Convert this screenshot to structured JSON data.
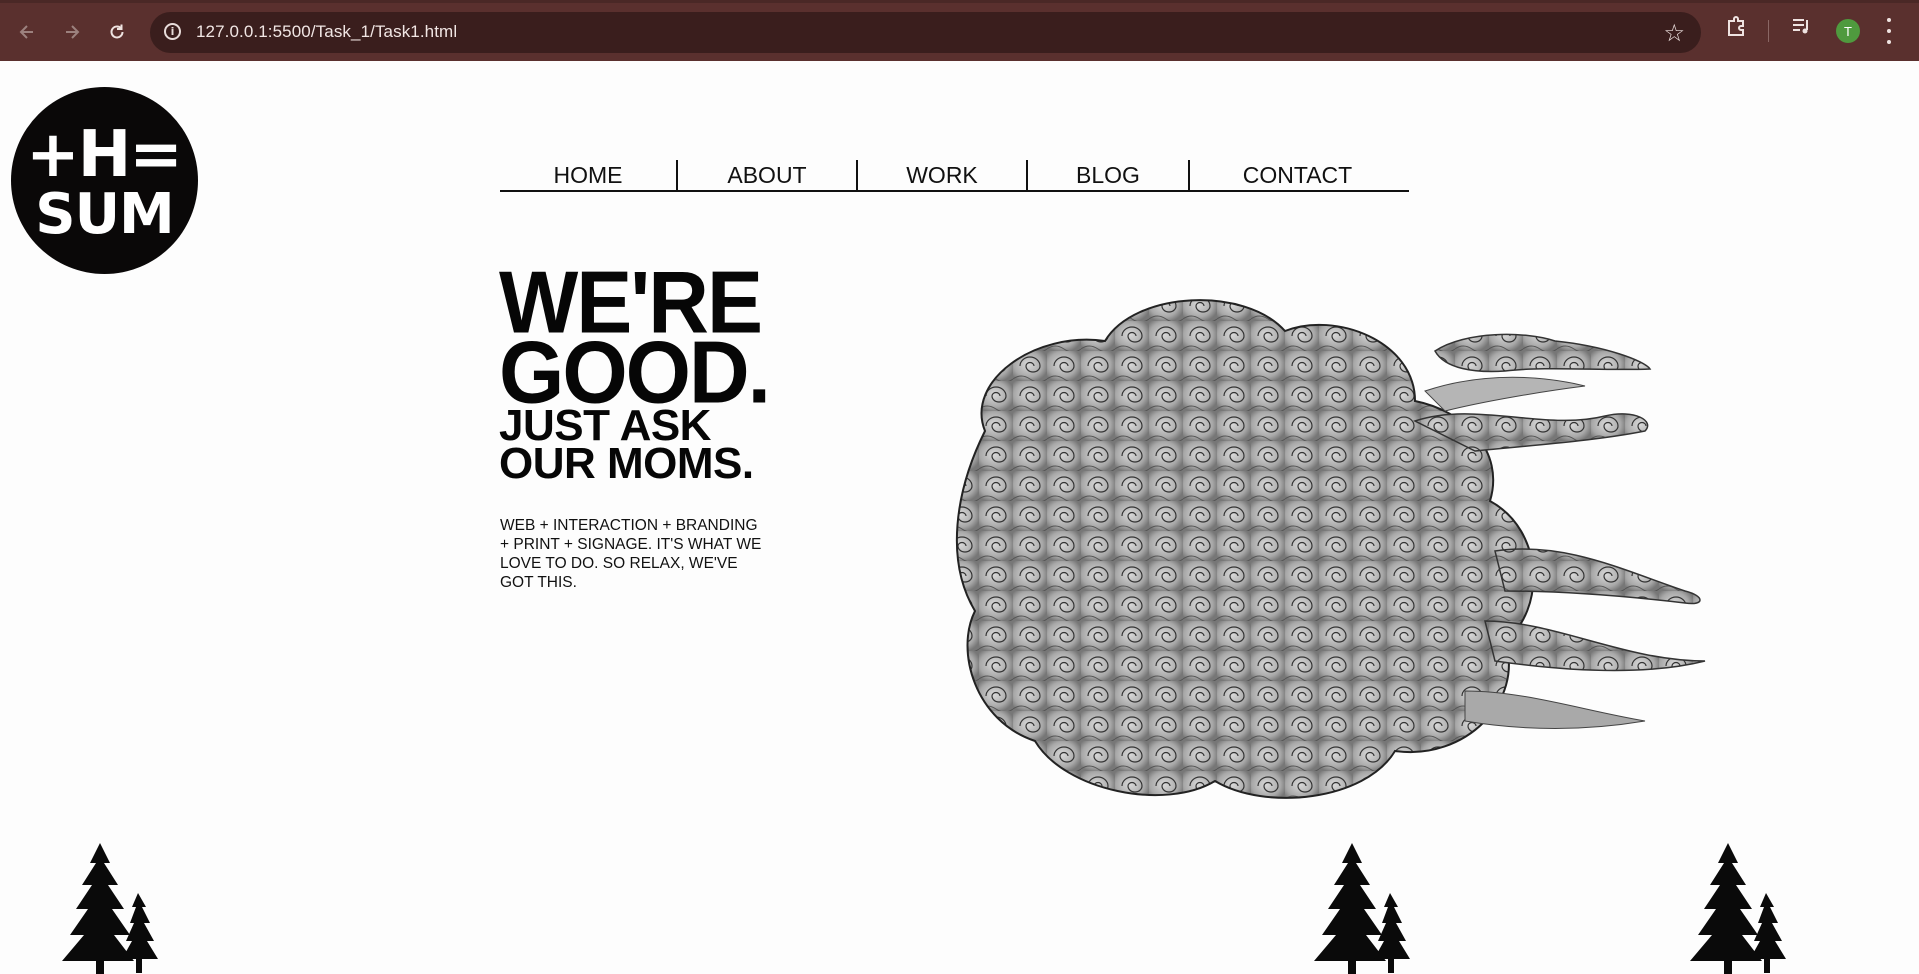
{
  "browser": {
    "url": "127.0.0.1:5500/Task_1/Task1.html",
    "back_icon": "back-arrow-icon",
    "forward_icon": "forward-arrow-icon",
    "reload_icon": "reload-icon",
    "avatar_initial": "T",
    "colors": {
      "toolbar": "#5a302e",
      "omnibox": "#3a1e1d",
      "avatar": "#4f9a3e"
    }
  },
  "logo": {
    "line1": "+H=",
    "line2": "SUM"
  },
  "nav": {
    "items": [
      {
        "label": "HOME"
      },
      {
        "label": "ABOUT"
      },
      {
        "label": "WORK"
      },
      {
        "label": "BLOG"
      },
      {
        "label": "CONTACT"
      }
    ]
  },
  "hero": {
    "line1": "WE'RE",
    "line2": "GOOD.",
    "line3": "JUST ASK",
    "line4": "OUR MOMS.",
    "tagline": "WEB + INTERACTION + BRANDING + PRINT + SIGNAGE. IT'S WHAT WE LOVE TO DO. SO RELAX, WE'VE GOT THIS."
  },
  "art": {
    "cloud_icon": "swirl-cloud-illustration",
    "tree_icon": "pine-tree-icon"
  }
}
